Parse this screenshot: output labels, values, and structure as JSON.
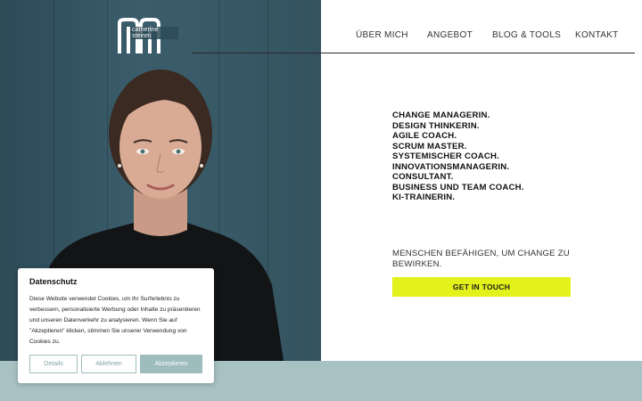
{
  "brand": {
    "logo_word": "catherine steinm"
  },
  "nav": {
    "items": [
      "ÜBER MICH",
      "ANGEBOT",
      "BLOG & TOOLS",
      "KONTAKT"
    ]
  },
  "hero": {
    "roles": [
      "CHANGE MANAGERIN.",
      "DESIGN THINKERIN.",
      "AGILE COACH.",
      "SCRUM MASTER.",
      "SYSTEMISCHER COACH.",
      "INNOVATIONSMANAGERIN.",
      "CONSULTANT.",
      "BUSINESS UND TEAM COACH.",
      "KI-TRAINERIN."
    ],
    "tagline": "MENSCHEN BEFÄHIGEN, UM CHANGE ZU BEWIRKEN.",
    "cta_label": "GET IN TOUCH"
  },
  "cookie": {
    "title": "Datenschutz",
    "body": "Diese Website verwendet Cookies, um Ihr Surferlebnis zu verbessern, personalisierte Werbung oder Inhalte zu präsentieren und unseren Datenverkehr zu analysieren. Wenn Sie auf \"Akzeptieren\" klicken, stimmen Sie unserer Verwendung von Cookies zu.",
    "details_label": "Details",
    "reject_label": "Ablehnen",
    "accept_label": "Akzeptieren"
  },
  "colors": {
    "accent": "#e4f21b",
    "band": "#a8c1c2",
    "cookie_button": "#9dbcbd",
    "photo_bg": "#34535f"
  }
}
